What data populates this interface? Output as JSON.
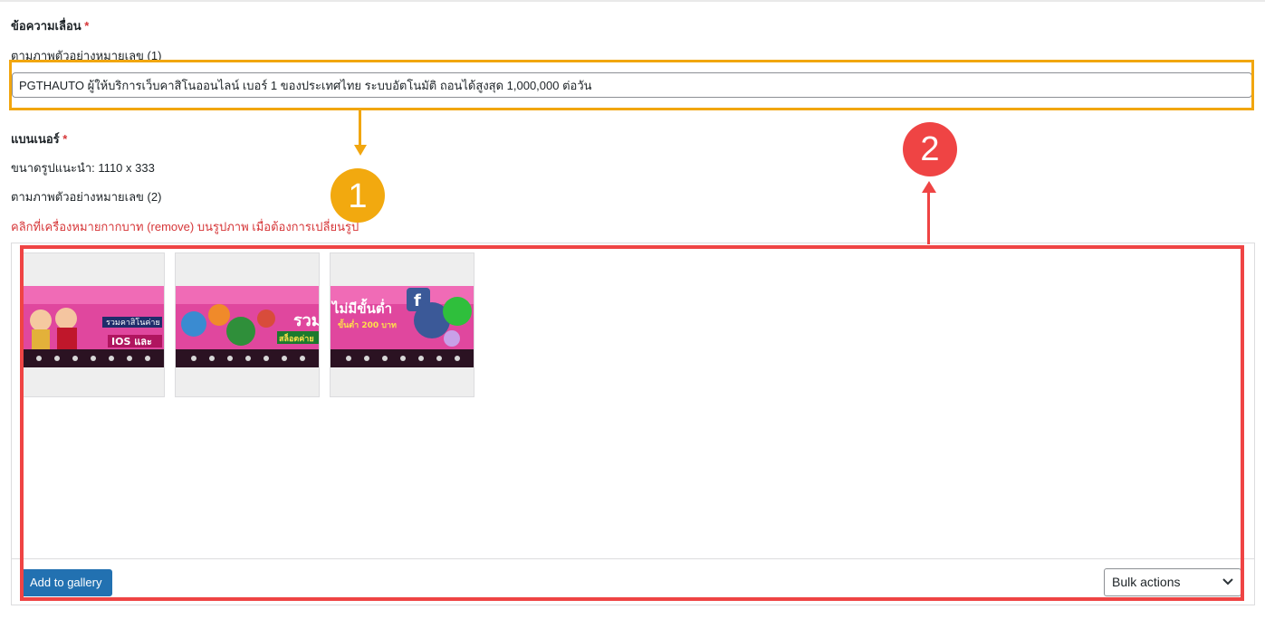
{
  "marquee": {
    "label": "ข้อความเลื่อน",
    "required": "*",
    "hint": "ตามภาพตัวอย่างหมายเลข (1)",
    "value": "PGTHAUTO ผู้ให้บริการเว็บคาสิโนออนไลน์ เบอร์ 1 ของประเทศไทย ระบบอัตโนมัติ ถอนได้สูงสุด 1,000,000 ต่อวัน"
  },
  "banner": {
    "label": "แบนเนอร์",
    "required": "*",
    "size_hint": "ขนาดรูปแนะนำ: 1110 x 333",
    "hint": "ตามภาพตัวอย่างหมายเลข (2)",
    "warning": "คลิกที่เครื่องหมายกากบาท (remove) บนรูปภาพ เมื่อต้องการเปลี่ยนรูป"
  },
  "gallery": {
    "thumbnails": [
      {
        "caption": "รวมคาสิโนค่าย",
        "sub": "IOS และ"
      },
      {
        "caption": "รวม",
        "sub": "สล็อตค่าย"
      },
      {
        "caption": "ไม่มีขั้นต่ำ",
        "sub": "ขั้นต่ำ 200 บาท"
      }
    ],
    "add_button": "Add to gallery",
    "bulk_actions": "Bulk actions"
  },
  "annotations": {
    "badge1": "1",
    "badge2": "2",
    "orange": "#f1a60f",
    "red": "#ef4444"
  },
  "colors": {
    "accent": "#2271b1",
    "required": "#d63638"
  }
}
